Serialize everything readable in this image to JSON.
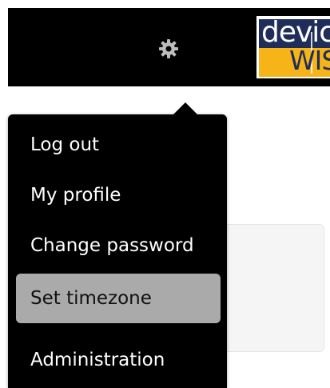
{
  "header": {
    "settings_icon": "gear-icon",
    "logo": {
      "line1": "device",
      "line2": "WISE",
      "colors": {
        "navy": "#1e2d59",
        "gold": "#f6b418"
      }
    }
  },
  "menu": {
    "items": [
      {
        "label": "Log out"
      },
      {
        "label": "My profile"
      },
      {
        "label": "Change password"
      },
      {
        "label": "Set timezone",
        "active": true
      },
      {
        "label": "Administration"
      }
    ]
  }
}
